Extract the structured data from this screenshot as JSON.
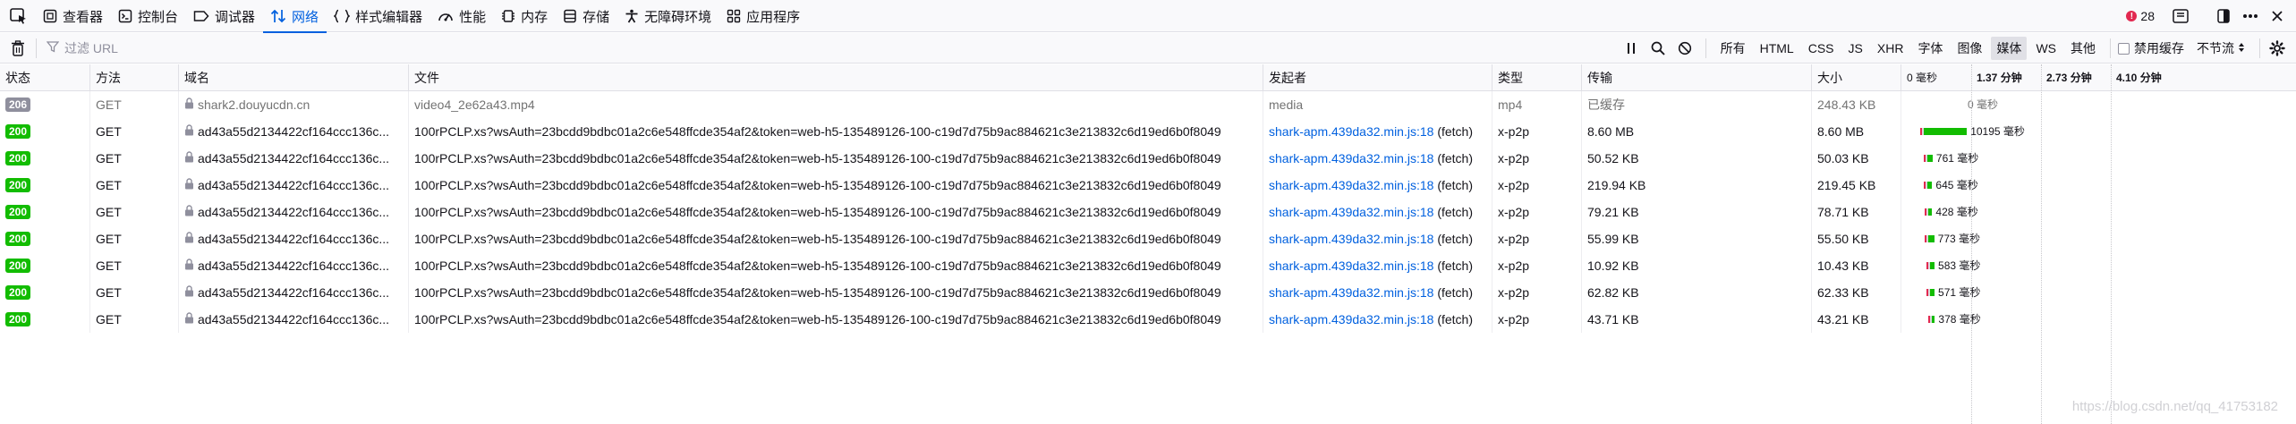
{
  "tabs": [
    {
      "id": "inspector",
      "label": "查看器",
      "icon": "inspector-icon",
      "active": false
    },
    {
      "id": "console",
      "label": "控制台",
      "icon": "console-icon",
      "active": false
    },
    {
      "id": "debugger",
      "label": "调试器",
      "icon": "debugger-icon",
      "active": false
    },
    {
      "id": "network",
      "label": "网络",
      "icon": "network-icon",
      "active": true
    },
    {
      "id": "styleeditor",
      "label": "样式编辑器",
      "icon": "style-editor-icon",
      "active": false
    },
    {
      "id": "performance",
      "label": "性能",
      "icon": "performance-icon",
      "active": false
    },
    {
      "id": "memory",
      "label": "内存",
      "icon": "memory-icon",
      "active": false
    },
    {
      "id": "storage",
      "label": "存储",
      "icon": "storage-icon",
      "active": false
    },
    {
      "id": "accessibility",
      "label": "无障碍环境",
      "icon": "accessibility-icon",
      "active": false
    },
    {
      "id": "application",
      "label": "应用程序",
      "icon": "application-icon",
      "active": false
    }
  ],
  "error_count": "28",
  "toolbar": {
    "filter_placeholder": "过滤 URL",
    "type_filters": [
      {
        "label": "所有",
        "active": false
      },
      {
        "label": "HTML",
        "active": false
      },
      {
        "label": "CSS",
        "active": false
      },
      {
        "label": "JS",
        "active": false
      },
      {
        "label": "XHR",
        "active": false
      },
      {
        "label": "字体",
        "active": false
      },
      {
        "label": "图像",
        "active": false
      },
      {
        "label": "媒体",
        "active": true
      },
      {
        "label": "WS",
        "active": false
      },
      {
        "label": "其他",
        "active": false
      }
    ],
    "disable_cache_label": "禁用缓存",
    "throttle_label": "不节流"
  },
  "columns": {
    "status": "状态",
    "method": "方法",
    "domain": "域名",
    "file": "文件",
    "initiator": "发起者",
    "type": "类型",
    "transferred": "传输",
    "size": "大小",
    "waterfall_ticks": [
      "0 毫秒",
      "1.37 分钟",
      "2.73 分钟",
      "4.10 分钟"
    ]
  },
  "rows": [
    {
      "status": "206",
      "method": "GET",
      "domain": "shark2.douyucdn.cn",
      "file": "video4_2e62a43.mp4",
      "initiator_link": "",
      "initiator_type": "media",
      "type": "mp4",
      "transferred": "已缓存",
      "size": "248.43 KB",
      "timing": "0 毫秒",
      "cached": true,
      "wf_start": 0,
      "wf_dur": 0
    },
    {
      "status": "200",
      "method": "GET",
      "domain": "ad43a55d2134422cf164ccc136c...",
      "file": "100rPCLP.xs?wsAuth=23bcdd9bdbc01a2c6e548ffcde354af2&token=web-h5-135489126-100-c19d7d75b9ac884621c3e213832c6d19ed6b0f8049",
      "initiator_link": "shark-apm.439da32.min.js:18",
      "initiator_type": " (fetch)",
      "type": "x-p2p",
      "transferred": "8.60 MB",
      "size": "8.60 MB",
      "timing": "10195 毫秒",
      "cached": false,
      "wf_start": 0.012,
      "wf_dur": 0.0295
    },
    {
      "status": "200",
      "method": "GET",
      "domain": "ad43a55d2134422cf164ccc136c...",
      "file": "100rPCLP.xs?wsAuth=23bcdd9bdbc01a2c6e548ffcde354af2&token=web-h5-135489126-100-c19d7d75b9ac884621c3e213832c6d19ed6b0f8049",
      "initiator_link": "shark-apm.439da32.min.js:18",
      "initiator_type": " (fetch)",
      "type": "x-p2p",
      "transferred": "50.52 KB",
      "size": "50.03 KB",
      "timing": "761 毫秒",
      "cached": false,
      "wf_start": 0.014,
      "wf_dur": 0.0058
    },
    {
      "status": "200",
      "method": "GET",
      "domain": "ad43a55d2134422cf164ccc136c...",
      "file": "100rPCLP.xs?wsAuth=23bcdd9bdbc01a2c6e548ffcde354af2&token=web-h5-135489126-100-c19d7d75b9ac884621c3e213832c6d19ed6b0f8049",
      "initiator_link": "shark-apm.439da32.min.js:18",
      "initiator_type": " (fetch)",
      "type": "x-p2p",
      "transferred": "219.94 KB",
      "size": "219.45 KB",
      "timing": "645 毫秒",
      "cached": false,
      "wf_start": 0.014,
      "wf_dur": 0.0055
    },
    {
      "status": "200",
      "method": "GET",
      "domain": "ad43a55d2134422cf164ccc136c...",
      "file": "100rPCLP.xs?wsAuth=23bcdd9bdbc01a2c6e548ffcde354af2&token=web-h5-135489126-100-c19d7d75b9ac884621c3e213832c6d19ed6b0f8049",
      "initiator_link": "shark-apm.439da32.min.js:18",
      "initiator_type": " (fetch)",
      "type": "x-p2p",
      "transferred": "79.21 KB",
      "size": "78.71 KB",
      "timing": "428 毫秒",
      "cached": false,
      "wf_start": 0.015,
      "wf_dur": 0.0045
    },
    {
      "status": "200",
      "method": "GET",
      "domain": "ad43a55d2134422cf164ccc136c...",
      "file": "100rPCLP.xs?wsAuth=23bcdd9bdbc01a2c6e548ffcde354af2&token=web-h5-135489126-100-c19d7d75b9ac884621c3e213832c6d19ed6b0f8049",
      "initiator_link": "shark-apm.439da32.min.js:18",
      "initiator_type": " (fetch)",
      "type": "x-p2p",
      "transferred": "55.99 KB",
      "size": "55.50 KB",
      "timing": "773 毫秒",
      "cached": false,
      "wf_start": 0.015,
      "wf_dur": 0.0058
    },
    {
      "status": "200",
      "method": "GET",
      "domain": "ad43a55d2134422cf164ccc136c...",
      "file": "100rPCLP.xs?wsAuth=23bcdd9bdbc01a2c6e548ffcde354af2&token=web-h5-135489126-100-c19d7d75b9ac884621c3e213832c6d19ed6b0f8049",
      "initiator_link": "shark-apm.439da32.min.js:18",
      "initiator_type": " (fetch)",
      "type": "x-p2p",
      "transferred": "10.92 KB",
      "size": "10.43 KB",
      "timing": "583 毫秒",
      "cached": false,
      "wf_start": 0.016,
      "wf_dur": 0.005
    },
    {
      "status": "200",
      "method": "GET",
      "domain": "ad43a55d2134422cf164ccc136c...",
      "file": "100rPCLP.xs?wsAuth=23bcdd9bdbc01a2c6e548ffcde354af2&token=web-h5-135489126-100-c19d7d75b9ac884621c3e213832c6d19ed6b0f8049",
      "initiator_link": "shark-apm.439da32.min.js:18",
      "initiator_type": " (fetch)",
      "type": "x-p2p",
      "transferred": "62.82 KB",
      "size": "62.33 KB",
      "timing": "571 毫秒",
      "cached": false,
      "wf_start": 0.016,
      "wf_dur": 0.005
    },
    {
      "status": "200",
      "method": "GET",
      "domain": "ad43a55d2134422cf164ccc136c...",
      "file": "100rPCLP.xs?wsAuth=23bcdd9bdbc01a2c6e548ffcde354af2&token=web-h5-135489126-100-c19d7d75b9ac884621c3e213832c6d19ed6b0f8049",
      "initiator_link": "shark-apm.439da32.min.js:18",
      "initiator_type": " (fetch)",
      "type": "x-p2p",
      "transferred": "43.71 KB",
      "size": "43.21 KB",
      "timing": "378 毫秒",
      "cached": false,
      "wf_start": 0.017,
      "wf_dur": 0.0042
    }
  ],
  "watermark": "https://blog.csdn.net/qq_41753182",
  "colors": {
    "accent": "#0060df",
    "status_ok": "#12bc00",
    "status_cached": "#8f8f9d",
    "wf_wait": "#d7d7db",
    "wf_send": "#e22850",
    "wf_receive": "#12bc00"
  }
}
